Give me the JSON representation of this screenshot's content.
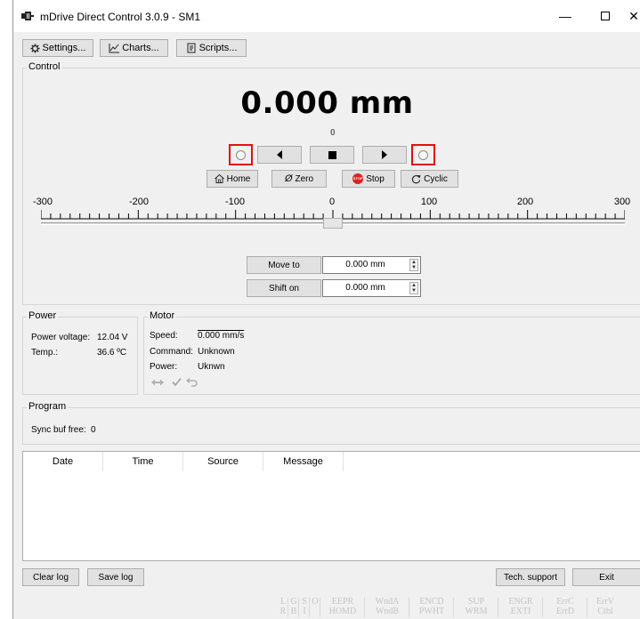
{
  "window": {
    "title": "mDrive Direct Control 3.0.9 - SM1",
    "min_glyph": "—",
    "close_glyph": "✕"
  },
  "toolbar": {
    "settings": "Settings...",
    "charts": "Charts...",
    "scripts": "Scripts..."
  },
  "control": {
    "title": "Control",
    "position": "0.000 mm",
    "sub_position": "0",
    "home": "Home",
    "zero": "Zero",
    "stop": "Stop",
    "stop_badge": "STOP",
    "cyclic": "Cyclic",
    "ruler_labels": [
      "-300",
      "-200",
      "-100",
      "0",
      "100",
      "200",
      "300"
    ],
    "slider_value": 0,
    "move_to": "Move to",
    "move_to_value": "0.000 mm",
    "shift_on": "Shift on",
    "shift_on_value": "0.000 mm"
  },
  "power": {
    "title": "Power",
    "voltage_label": "Power voltage:",
    "voltage_value": "12.04 V",
    "temp_label": "Temp.:",
    "temp_value": "36.6 ºC"
  },
  "motor": {
    "title": "Motor",
    "speed_label": "Speed:",
    "speed_value": "0.000 mm/s",
    "command_label": "Command:",
    "command_value": "Unknown",
    "power_label": "Power:",
    "power_value": "Uknwn"
  },
  "program": {
    "title": "Program",
    "sync_label": "Sync buf free:",
    "sync_value": "0"
  },
  "log": {
    "columns": [
      "Date",
      "Time",
      "Source",
      "Message"
    ]
  },
  "footer": {
    "clear_log": "Clear log",
    "save_log": "Save log",
    "tech_support": "Tech. support",
    "exit": "Exit"
  },
  "status_flags": [
    {
      "top": "L",
      "bottom": "R"
    },
    {
      "top": "G",
      "bottom": "B"
    },
    {
      "top": "S",
      "bottom": "I"
    },
    {
      "top": "O",
      "bottom": ""
    },
    {
      "top": "EEPR",
      "bottom": "HOMD"
    },
    {
      "top": "WndA",
      "bottom": "WndB"
    },
    {
      "top": "ENCD",
      "bottom": "PWHT"
    },
    {
      "top": "SUP",
      "bottom": "WRM"
    },
    {
      "top": "ENGR",
      "bottom": "EXTI"
    },
    {
      "top": "ErrC",
      "bottom": "ErrD"
    },
    {
      "top": "ErrV",
      "bottom": "Ctbl"
    }
  ],
  "colors": {
    "red_frame": "#e01010",
    "stop_badge": "#e02020",
    "window_bg": "#f0f0f0"
  }
}
